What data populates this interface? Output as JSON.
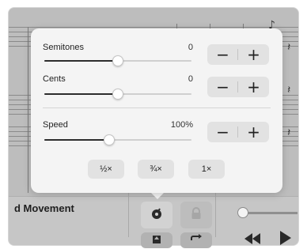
{
  "popover": {
    "semitones": {
      "label": "Semitones",
      "value": "0",
      "level": 0.5
    },
    "cents": {
      "label": "Cents",
      "value": "0",
      "level": 0.5
    },
    "speed": {
      "label": "Speed",
      "value": "100%",
      "level": 0.44
    },
    "stepper": {
      "minus": "−",
      "plus": "+"
    },
    "speed_presets": [
      "½×",
      "¾×",
      "1×"
    ]
  },
  "bottom_bar": {
    "track_title": "d Movement"
  },
  "icons": {
    "metronome": "metronome-icon",
    "lock": "lock-icon",
    "rewind": "rewind-icon",
    "play": "play-icon",
    "loop": "loop-icon",
    "export": "export-icon"
  },
  "colors": {
    "popover_bg": "#f4f4f4",
    "slider_fill": "#2d2d2d",
    "stepper_bg": "#e2e2e2"
  }
}
